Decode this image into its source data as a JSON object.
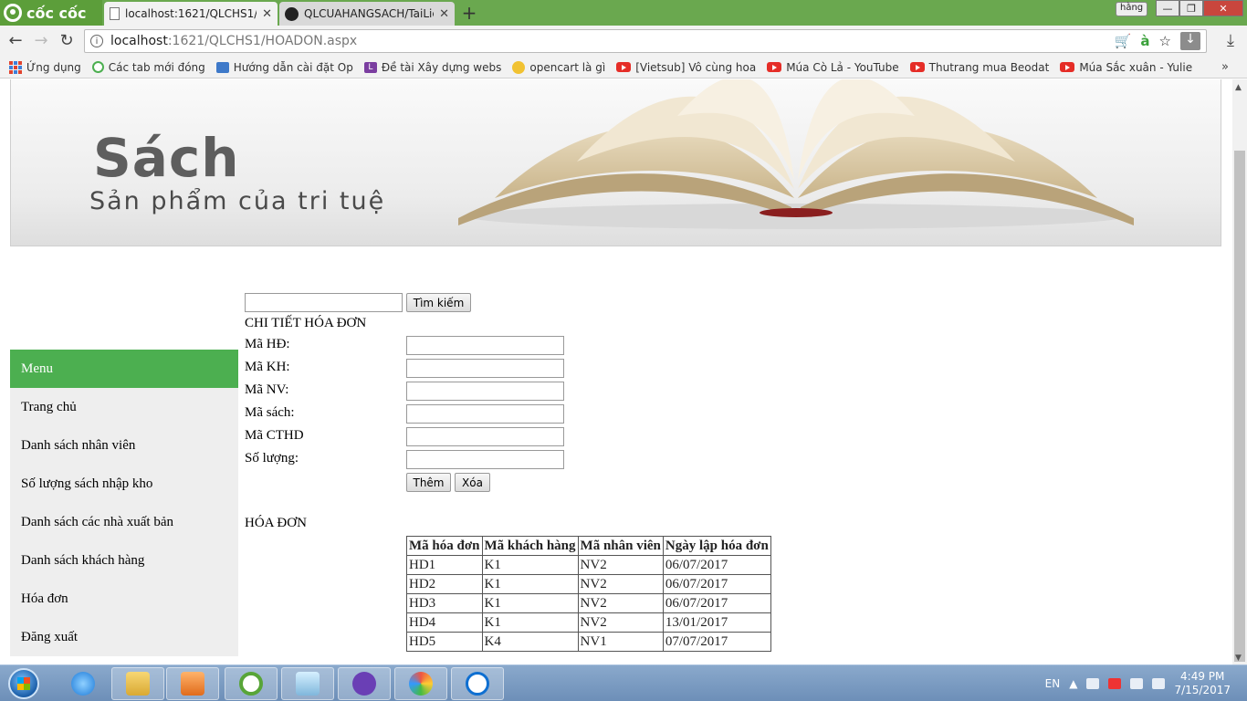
{
  "browser": {
    "brand": "cốc cốc",
    "user": "hằng",
    "tabs": [
      {
        "title": "localhost:1621/QLCHS1/H",
        "active": true
      },
      {
        "title": "QLCUAHANGSACH/TaiLie",
        "active": false
      }
    ],
    "url_host": "localhost",
    "url_path": ":1621/QLCHS1/HOADON.aspx",
    "bookmarks": [
      {
        "label": "Ứng dụng",
        "icon": "apps-icon"
      },
      {
        "label": "Các tab mới đóng",
        "icon": "recent-tabs-icon"
      },
      {
        "label": "Hướng dẫn cài đặt Op",
        "icon": "page-icon"
      },
      {
        "label": "Đề tài Xây dựng webs",
        "icon": "l-icon"
      },
      {
        "label": "opencart là gì",
        "icon": "opencart-icon"
      },
      {
        "label": "[Vietsub] Vô cùng hoa",
        "icon": "youtube-icon"
      },
      {
        "label": "Múa Cò Lả - YouTube",
        "icon": "youtube-icon"
      },
      {
        "label": "Thutrang mua Beodat",
        "icon": "youtube-icon"
      },
      {
        "label": "Múa Sắc xuân - Yulie",
        "icon": "youtube-icon"
      }
    ]
  },
  "banner": {
    "title": "Sách",
    "subtitle": "Sản phẩm của tri tuệ"
  },
  "menu": {
    "header": "Menu",
    "items": [
      "Trang chủ",
      "Danh sách nhân viên",
      "Số lượng sách nhập kho",
      "Danh sách các nhà xuất bản",
      "Danh sách khách hàng",
      "Hóa đơn",
      "Đăng xuất"
    ]
  },
  "search": {
    "value": "",
    "button": "Tìm kiếm"
  },
  "detail_form": {
    "title": "CHI TIẾT HÓA ĐƠN",
    "fields": [
      {
        "label": "Mã HĐ:",
        "value": ""
      },
      {
        "label": "Mã KH:",
        "value": ""
      },
      {
        "label": "Mã NV:",
        "value": ""
      },
      {
        "label": "Mã sách:",
        "value": ""
      },
      {
        "label": "Mã CTHD",
        "value": ""
      },
      {
        "label": "Số lượng:",
        "value": ""
      }
    ],
    "add_button": "Thêm",
    "delete_button": "Xóa"
  },
  "invoices": {
    "title": "HÓA ĐƠN",
    "columns": [
      "Mã hóa đơn",
      "Mã khách hàng",
      "Mã nhân viên",
      "Ngày lập hóa đơn"
    ],
    "rows": [
      [
        "HD1",
        "K1",
        "NV2",
        "06/07/2017"
      ],
      [
        "HD2",
        "K1",
        "NV2",
        "06/07/2017"
      ],
      [
        "HD3",
        "K1",
        "NV2",
        "06/07/2017"
      ],
      [
        "HD4",
        "K1",
        "NV2",
        "13/01/2017"
      ],
      [
        "HD5",
        "K4",
        "NV1",
        "07/07/2017"
      ]
    ]
  },
  "taskbar": {
    "language": "EN",
    "time": "4:49 PM",
    "date": "7/15/2017"
  },
  "colors": {
    "menu_header": "#4caf50",
    "menu_item_bg": "#eeeeee",
    "tabstrip": "#6aa84f"
  }
}
